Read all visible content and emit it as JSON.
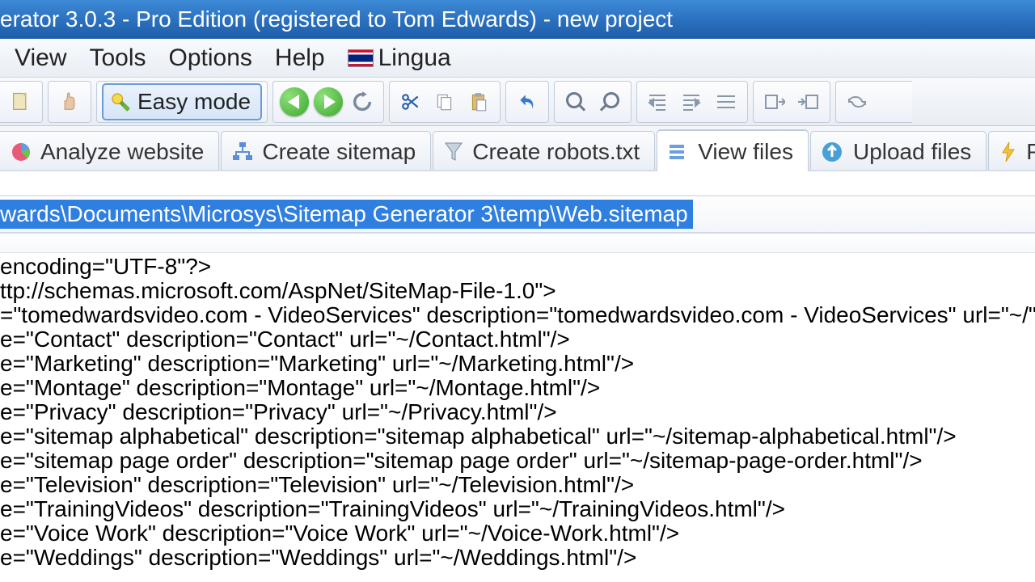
{
  "window": {
    "title": "erator 3.0.3 - Pro Edition (registered to Tom Edwards) - new project"
  },
  "menu": {
    "view": "View",
    "tools": "Tools",
    "options": "Options",
    "help": "Help",
    "lingua": "Lingua"
  },
  "toolbar": {
    "easy_mode": "Easy mode"
  },
  "tabs": {
    "analyze": "Analyze website",
    "create_sitemap": "Create sitemap",
    "create_robots": "Create robots.txt",
    "view_files": "View files",
    "upload_files": "Upload files",
    "partial": "P"
  },
  "path": {
    "value": "wards\\Documents\\Microsys\\Sitemap Generator 3\\temp\\Web.sitemap"
  },
  "file": {
    "l1": " encoding=\"UTF-8\"?>",
    "l2": "ttp://schemas.microsoft.com/AspNet/SiteMap-File-1.0\">",
    "l3": "=\"tomedwardsvideo.com - VideoServices\" description=\"tomedwardsvideo.com - VideoServices\" url=\"~/\">",
    "l4": "e=\"Contact\" description=\"Contact\" url=\"~/Contact.html\"/>",
    "l5": "e=\"Marketing\" description=\"Marketing\" url=\"~/Marketing.html\"/>",
    "l6": "e=\"Montage\" description=\"Montage\" url=\"~/Montage.html\"/>",
    "l7": "e=\"Privacy\" description=\"Privacy\" url=\"~/Privacy.html\"/>",
    "l8": "e=\"sitemap alphabetical\" description=\"sitemap alphabetical\" url=\"~/sitemap-alphabetical.html\"/>",
    "l9": "e=\"sitemap page order\" description=\"sitemap page order\" url=\"~/sitemap-page-order.html\"/>",
    "l10": "e=\"Television\" description=\"Television\" url=\"~/Television.html\"/>",
    "l11": "e=\"TrainingVideos\" description=\"TrainingVideos\" url=\"~/TrainingVideos.html\"/>",
    "l12": "e=\"Voice Work\" description=\"Voice Work\" url=\"~/Voice-Work.html\"/>",
    "l13": "e=\"Weddings\" description=\"Weddings\" url=\"~/Weddings.html\"/>"
  }
}
